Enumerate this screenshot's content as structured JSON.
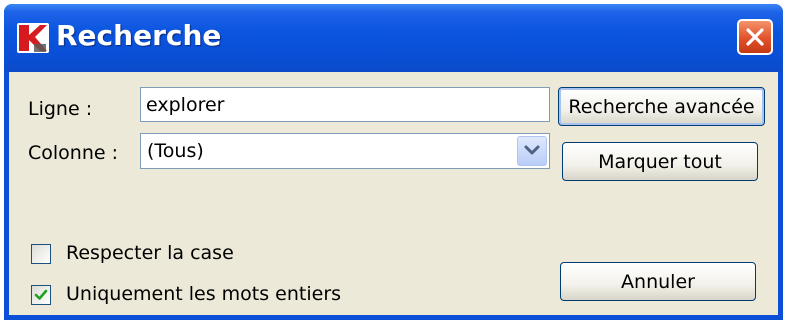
{
  "window": {
    "title": "Recherche",
    "icons": {
      "app": "kaspersky-logo-icon",
      "close": "close-x-icon"
    }
  },
  "form": {
    "ligne_label": "Ligne :",
    "ligne_value": "explorer",
    "colonne_label": "Colonne :",
    "colonne_value": "(Tous)"
  },
  "buttons": {
    "advanced": "Recherche avancée",
    "mark_all": "Marquer tout",
    "cancel": "Annuler"
  },
  "options": {
    "match_case": {
      "label": "Respecter la case",
      "checked": false
    },
    "whole_words": {
      "label": "Uniquement les mots entiers",
      "checked": true
    }
  },
  "colors": {
    "title_bar": "#0a4fd6",
    "client_bg": "#ece9d8",
    "close_button": "#e2512a",
    "accent_check": "#21a121"
  }
}
